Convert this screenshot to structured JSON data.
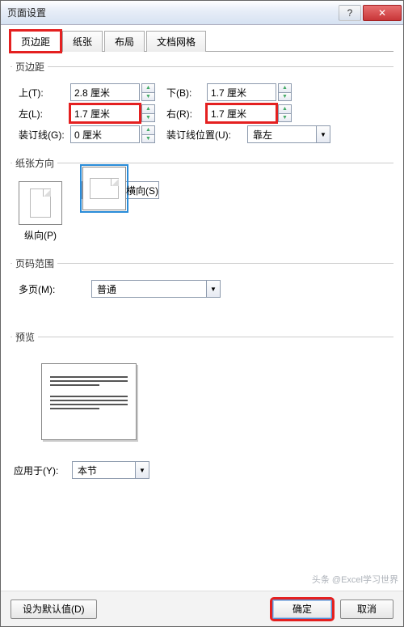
{
  "window": {
    "title": "页面设置"
  },
  "tabs": {
    "t0": "页边距",
    "t1": "纸张",
    "t2": "布局",
    "t3": "文档网格"
  },
  "margins": {
    "legend": "页边距",
    "top_lbl": "上(T):",
    "top_val": "2.8 厘米",
    "bottom_lbl": "下(B):",
    "bottom_val": "1.7 厘米",
    "left_lbl": "左(L):",
    "left_val": "1.7 厘米",
    "right_lbl": "右(R):",
    "right_val": "1.7 厘米",
    "gutter_lbl": "装订线(G):",
    "gutter_val": "0 厘米",
    "gutter_pos_lbl": "装订线位置(U):",
    "gutter_pos_val": "靠左"
  },
  "orientation": {
    "legend": "纸张方向",
    "portrait": "纵向(P)",
    "landscape": "横向(S)"
  },
  "pages": {
    "legend": "页码范围",
    "multi_lbl": "多页(M):",
    "multi_val": "普通"
  },
  "preview": {
    "legend": "预览"
  },
  "apply": {
    "lbl": "应用于(Y):",
    "val": "本节"
  },
  "footer": {
    "default": "设为默认值(D)",
    "ok": "确定",
    "cancel": "取消"
  },
  "watermark": "头条 @Excel学习世界"
}
